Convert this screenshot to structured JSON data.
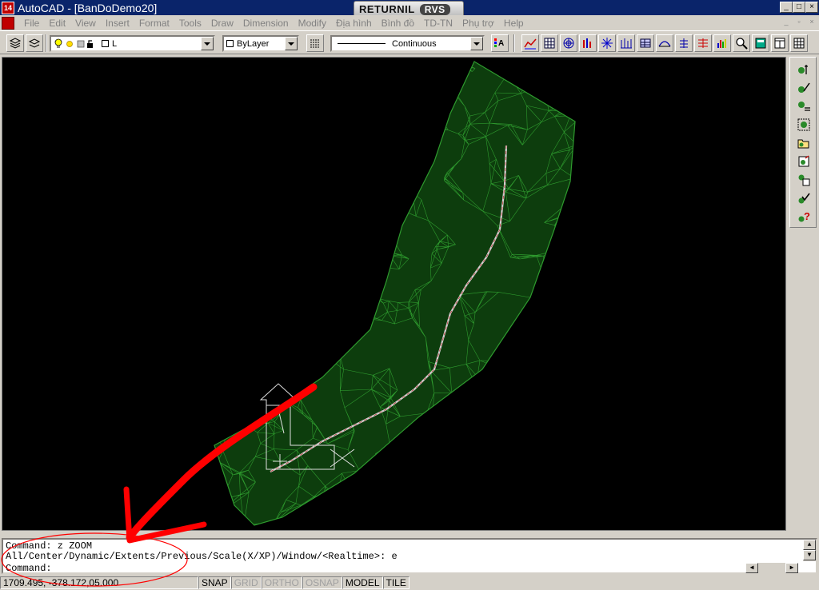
{
  "titlebar": {
    "app_icon_text": "14",
    "title": "AutoCAD - [BanDoDemo20]",
    "returnil_label": "RETURNIL",
    "returnil_badge": "RVS",
    "minimize": "_",
    "maximize": "□",
    "close": "×"
  },
  "menu": {
    "items": [
      "File",
      "Edit",
      "View",
      "Insert",
      "Format",
      "Tools",
      "Draw",
      "Dimension",
      "Modify",
      "Địa hình",
      "Bình đồ",
      "TD-TN",
      "Phụ trợ",
      "Help"
    ]
  },
  "toolbar": {
    "layer_value": "L",
    "color_value": "ByLayer",
    "linetype_value": "Continuous"
  },
  "command": {
    "line1": "Command: z ZOOM",
    "line2": "All/Center/Dynamic/Extents/Previous/Scale(X/XP)/Window/<Realtime>: e",
    "prompt": "Command:"
  },
  "status": {
    "coords": "1709.495, -378.172,05.000",
    "snap": "SNAP",
    "grid": "GRID",
    "ortho": "ORTHO",
    "osnap": "OSNAP",
    "model": "MODEL",
    "tile": "TILE"
  },
  "colors": {
    "mesh": "#2e9a2e",
    "background": "#000000",
    "annotation": "#ff0000",
    "titlebar": "#0a246a"
  },
  "icons": {
    "toolbar_left": [
      "layers-icon",
      "layer-previous-icon"
    ],
    "layer_state": [
      "lightbulb-icon",
      "sun-icon",
      "freeze-icon",
      "lock-icon"
    ],
    "toolbar_right": [
      "line-chart-icon",
      "table-icon",
      "target-icon",
      "bar-chart-icon",
      "node-icon",
      "section-icon",
      "grid-table-icon",
      "profile-icon",
      "cross-section-icon",
      "stack-icon",
      "multi-bar-icon",
      "zoom-icon",
      "calculator-icon",
      "window-icon"
    ],
    "right_panel": [
      "point-insert-icon",
      "point-edit-icon",
      "point-list-icon",
      "point-select-icon",
      "open-file-icon",
      "export-icon",
      "copy-icon",
      "check-icon",
      "help-icon"
    ]
  }
}
